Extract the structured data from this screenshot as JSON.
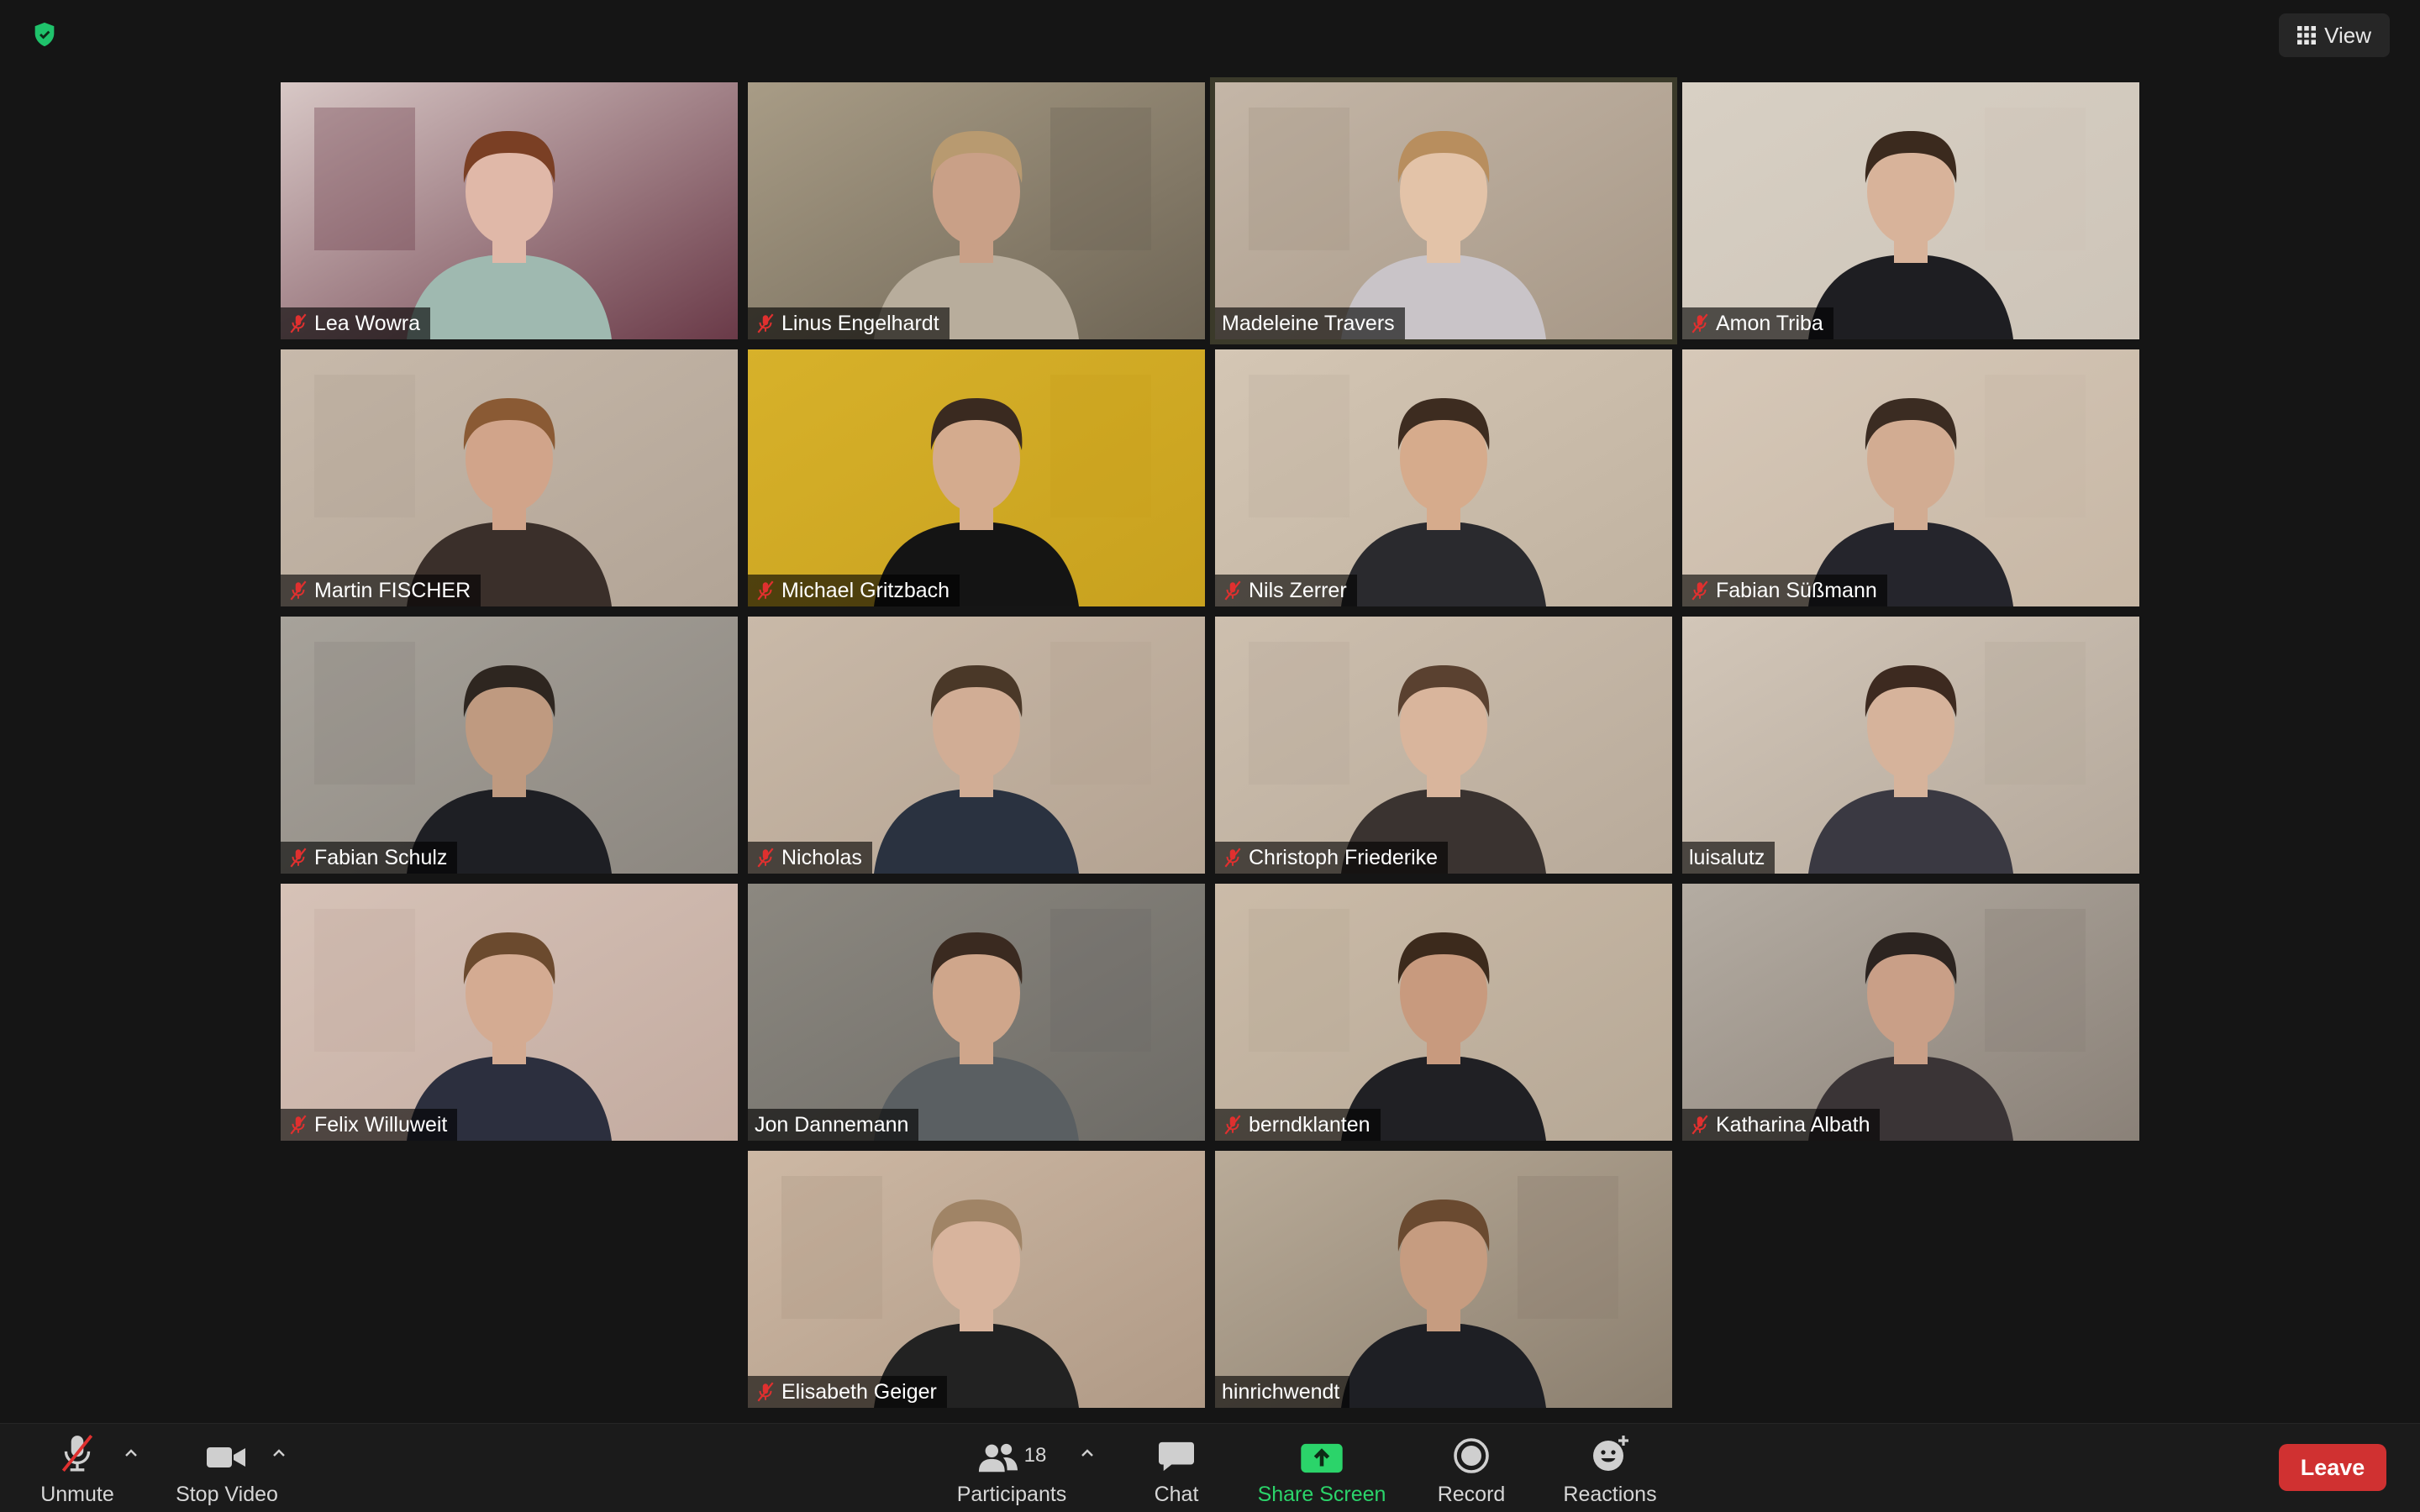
{
  "top": {
    "view_label": "View"
  },
  "participants": [
    {
      "name": "Lea Wowra",
      "muted": true,
      "bg": "#6a3a48",
      "wall": "#d8c8c6",
      "skin": "#e0b8a8",
      "hair": "#7a3f24",
      "shirt": "#9fb9b0"
    },
    {
      "name": "Linus Engelhardt",
      "muted": true,
      "bg": "#6e6555",
      "wall": "#a89c86",
      "skin": "#c9a087",
      "hair": "#b89a70",
      "shirt": "#b8ad9c"
    },
    {
      "name": "Madeleine Travers",
      "muted": false,
      "bg": "#a79887",
      "wall": "#c4b6a7",
      "skin": "#e3c3a8",
      "hair": "#b88e5e",
      "shirt": "#c9c4c8"
    },
    {
      "name": "Amon Triba",
      "muted": true,
      "bg": "#cdc4b8",
      "wall": "#d8d0c4",
      "skin": "#d8b39a",
      "hair": "#3b2a1e",
      "shirt": "#1e1e22"
    },
    {
      "name": "Martin FISCHER",
      "muted": true,
      "bg": "#b2a496",
      "wall": "#c7b9aa",
      "skin": "#d1a48a",
      "hair": "#8a5a34",
      "shirt": "#3a2f2a"
    },
    {
      "name": "Michael Gritzbach",
      "muted": true,
      "bg": "#c8a11e",
      "wall": "#d7b12a",
      "skin": "#d4ab8e",
      "hair": "#3a2a20",
      "shirt": "#141414"
    },
    {
      "name": "Nils Zerrer",
      "muted": true,
      "bg": "#c0b2a0",
      "wall": "#d4c6b4",
      "skin": "#d6ab8c",
      "hair": "#3d2c20",
      "shirt": "#2a2a2e"
    },
    {
      "name": "Fabian Süßmann",
      "muted": true,
      "bg": "#c7b7a5",
      "wall": "#d6c8b8",
      "skin": "#d2ac92",
      "hair": "#3b2c22",
      "shirt": "#25252c"
    },
    {
      "name": "Fabian Schulz",
      "muted": true,
      "bg": "#8c8780",
      "wall": "#a7a29a",
      "skin": "#bf9a80",
      "hair": "#2e2620",
      "shirt": "#1e1f24"
    },
    {
      "name": "Nicholas",
      "muted": true,
      "bg": "#b4a392",
      "wall": "#c9b9a8",
      "skin": "#d1ad95",
      "hair": "#4a3828",
      "shirt": "#2a3240"
    },
    {
      "name": "Christoph Friederike",
      "muted": true,
      "bg": "#b8aa9a",
      "wall": "#cdbfae",
      "skin": "#d9b59c",
      "hair": "#5a4130",
      "shirt": "#3a3330"
    },
    {
      "name": "luisalutz",
      "muted": false,
      "bg": "#b4a89b",
      "wall": "#d2c6b8",
      "skin": "#d6b39b",
      "hair": "#3d2a20",
      "shirt": "#3a3942"
    },
    {
      "name": "Felix Willuweit",
      "muted": true,
      "bg": "#c3aba0",
      "wall": "#d6c2b7",
      "skin": "#d4ab92",
      "hair": "#6b4a2e",
      "shirt": "#2c2f3e"
    },
    {
      "name": "Jon Dannemann",
      "muted": false,
      "bg": "#6d6b66",
      "wall": "#8c8880",
      "skin": "#cfa68b",
      "hair": "#3a2a20",
      "shirt": "#5a5f62"
    },
    {
      "name": "berndklanten",
      "muted": true,
      "bg": "#b6a896",
      "wall": "#cbbba8",
      "skin": "#c89a7e",
      "hair": "#3c2a1c",
      "shirt": "#202024"
    },
    {
      "name": "Katharina Albath",
      "muted": true,
      "bg": "#8a8178",
      "wall": "#b4aca2",
      "skin": "#c99f87",
      "hair": "#2c2420",
      "shirt": "#3a3436"
    },
    {
      "name": "Elisabeth Geiger",
      "muted": true,
      "bg": "#b09a86",
      "wall": "#cdb8a4",
      "skin": "#d8b49d",
      "hair": "#a08466",
      "shirt": "#222222"
    },
    {
      "name": "hinrichwendt",
      "muted": false,
      "bg": "#8b7f6f",
      "wall": "#b9ab98",
      "skin": "#c69c80",
      "hair": "#6a4a30",
      "shirt": "#1e1f24"
    }
  ],
  "toolbar": {
    "unmute_label": "Unmute",
    "stop_video_label": "Stop Video",
    "participants_label": "Participants",
    "participants_count": "18",
    "chat_label": "Chat",
    "share_label": "Share Screen",
    "record_label": "Record",
    "reactions_label": "Reactions",
    "leave_label": "Leave"
  },
  "colors": {
    "share_green": "#2bd46a",
    "leave_red": "#d03131",
    "mute_red": "#e0302f",
    "shield_green": "#1fc26b"
  }
}
